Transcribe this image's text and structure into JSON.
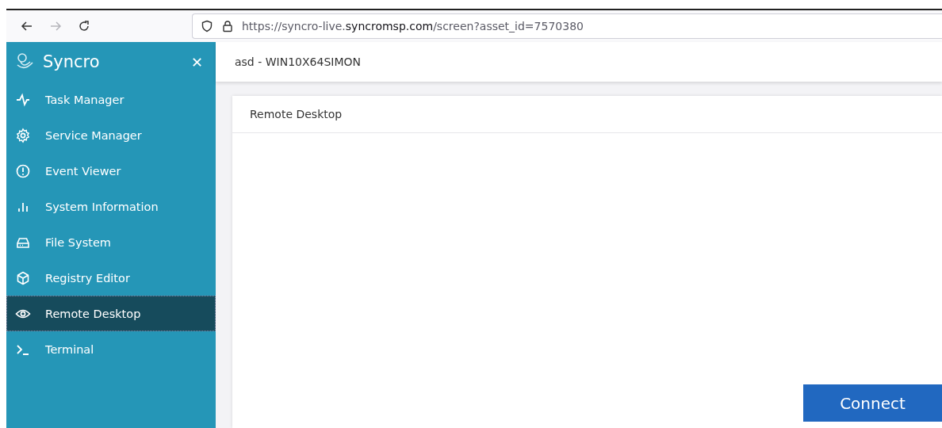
{
  "browser": {
    "url": "https://syncro-live.**syncromsp.com**/screen?asset_id=7570380",
    "back_disabled": false,
    "forward_disabled": true
  },
  "sidebar": {
    "brand": "Syncro",
    "close": "✕",
    "items": [
      {
        "label": "Task Manager",
        "selected": false
      },
      {
        "label": "Service Manager",
        "selected": false
      },
      {
        "label": "Event Viewer",
        "selected": false
      },
      {
        "label": "System Information",
        "selected": false
      },
      {
        "label": "File System",
        "selected": false
      },
      {
        "label": "Registry Editor",
        "selected": false
      },
      {
        "label": "Remote Desktop",
        "selected": true
      },
      {
        "label": "Terminal",
        "selected": false
      }
    ]
  },
  "header": {
    "title": "asd - WIN10X64SIMON"
  },
  "card": {
    "title": "Remote Desktop",
    "button": "Connect"
  }
}
